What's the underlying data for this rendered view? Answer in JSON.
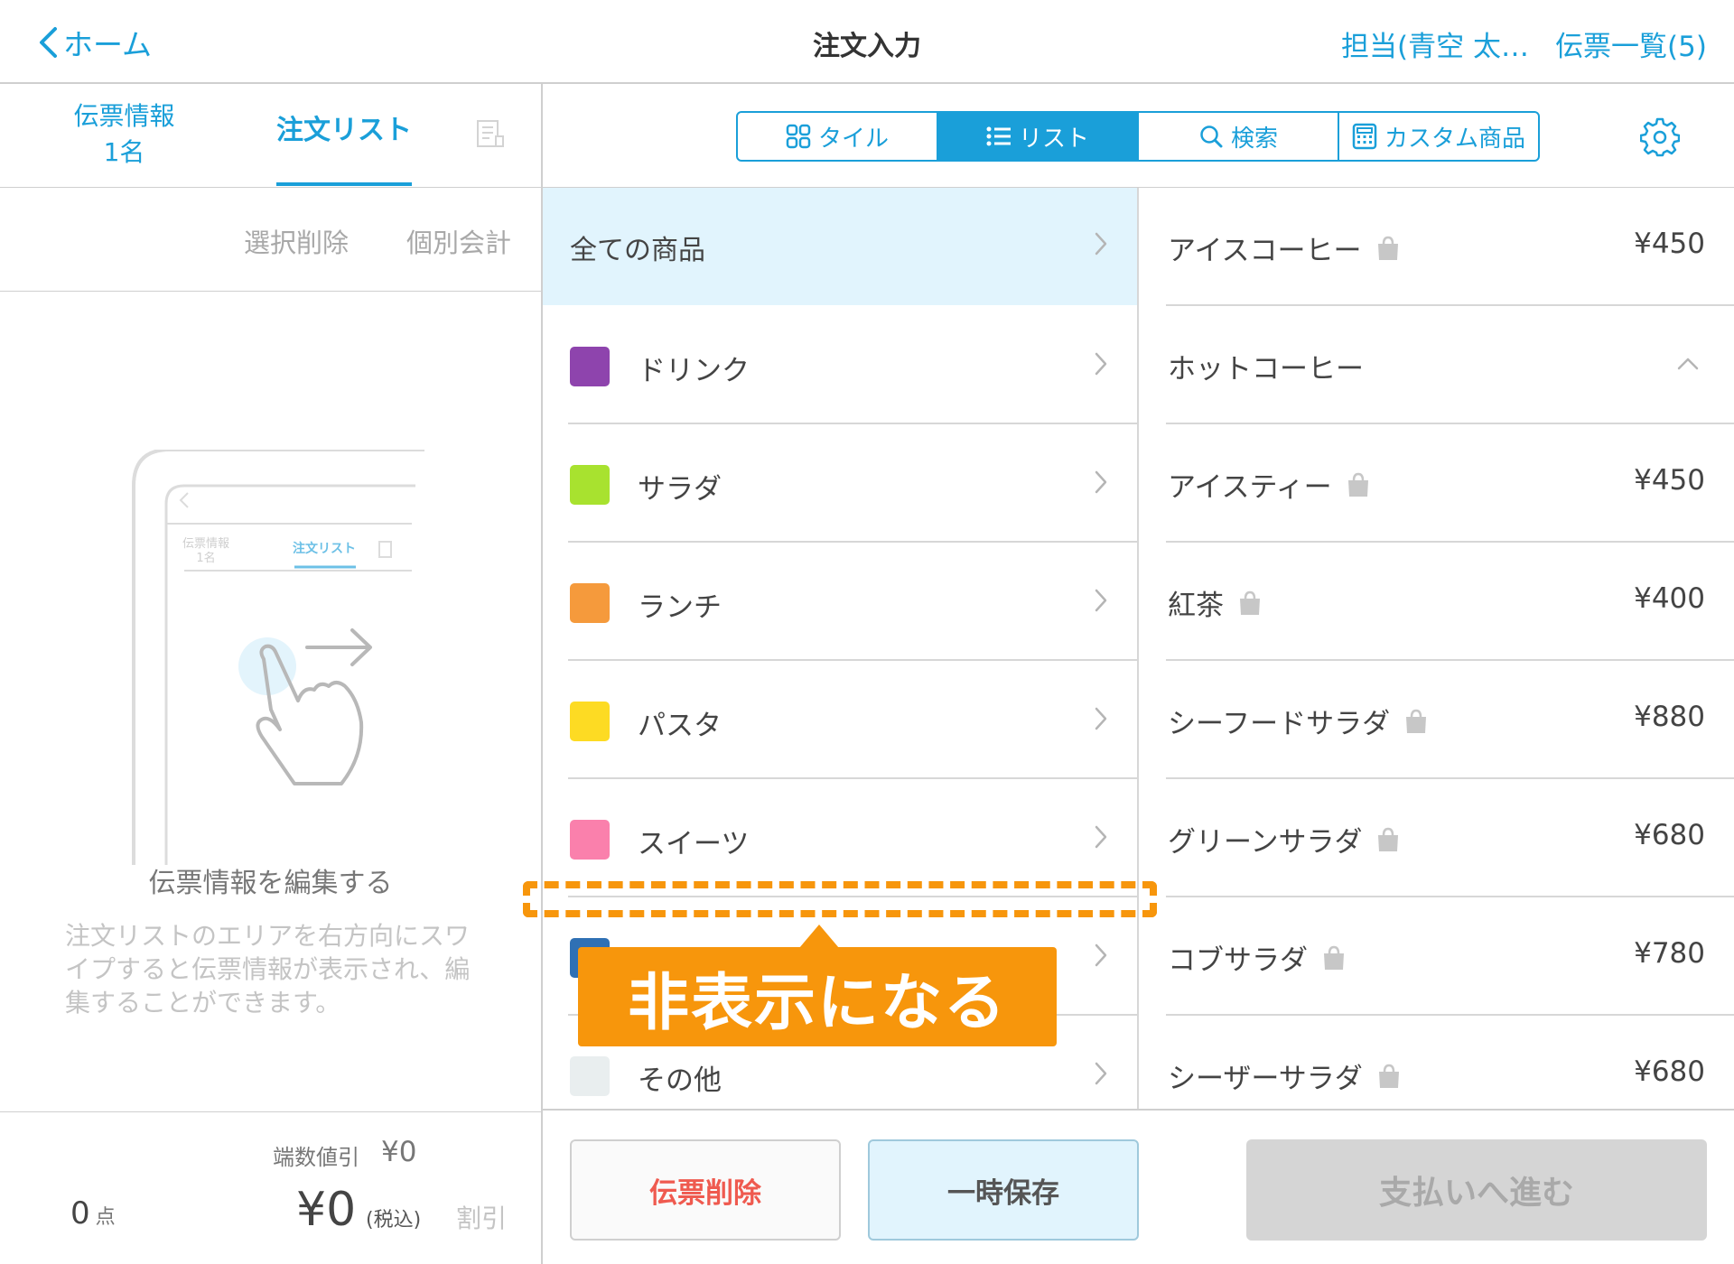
{
  "topbar": {
    "back_label": "ホーム",
    "title": "注文入力",
    "staff": "担当(青空 太…",
    "slips": "伝票一覧(5)"
  },
  "left_tabs": {
    "info_line1": "伝票情報",
    "info_line2": "1名",
    "order_list": "注文リスト"
  },
  "left_actions": {
    "delete_selected": "選択削除",
    "split_bill": "個別会計"
  },
  "illustration": {
    "mini_info_line1": "伝票情報",
    "mini_info_line2": "1名",
    "mini_order_list": "注文リスト"
  },
  "empty_state": {
    "title": "伝票情報を編集する",
    "description": "注文リストのエリアを右方向にスワイプすると伝票情報が表示され、編集することができます。"
  },
  "left_footer": {
    "rounding_label": "端数値引",
    "rounding_value": "¥0",
    "count": "0",
    "count_unit": "点",
    "total": "¥0",
    "tax_note": "(税込)",
    "discount": "割引"
  },
  "view_toggle": {
    "tile": "タイル",
    "list": "リスト",
    "search": "検索",
    "custom": "カスタム商品",
    "active": "list"
  },
  "categories": [
    {
      "label": "ドリンク",
      "color": "#8e44ad"
    },
    {
      "label": "サラダ",
      "color": "#a8e22f"
    },
    {
      "label": "ランチ",
      "color": "#f59a3c"
    },
    {
      "label": "パスタ",
      "color": "#fddb23"
    },
    {
      "label": "スイーツ",
      "color": "#fa80ac"
    },
    {
      "label": "",
      "color": "#2f70b4"
    },
    {
      "label": "その他",
      "color": "#e9eeef"
    }
  ],
  "category_all": "全ての商品",
  "products": [
    {
      "name": "アイスコーヒー",
      "price": "¥450",
      "bag": true
    },
    {
      "name": "ホットコーヒー",
      "price": "",
      "bag": false
    },
    {
      "name": "アイスティー",
      "price": "¥450",
      "bag": true
    },
    {
      "name": "紅茶",
      "price": "¥400",
      "bag": true
    },
    {
      "name": "シーフードサラダ",
      "price": "¥880",
      "bag": true
    },
    {
      "name": "グリーンサラダ",
      "price": "¥680",
      "bag": true
    },
    {
      "name": "コブサラダ",
      "price": "¥780",
      "bag": true
    },
    {
      "name": "シーザーサラダ",
      "price": "¥680",
      "bag": true
    }
  ],
  "bottom_buttons": {
    "delete_slip": "伝票削除",
    "hold": "一時保存",
    "proceed_payment": "支払いへ進む"
  },
  "annotation": {
    "callout": "非表示になる",
    "color": "#f7960c"
  },
  "colors": {
    "accent": "#1a9fd9",
    "selected_bg": "#e1f4fd",
    "danger": "#ef5a4f"
  }
}
